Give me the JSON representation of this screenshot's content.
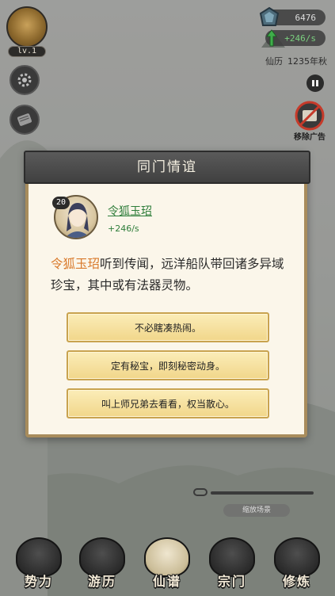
{
  "player": {
    "level_label": "lv.1"
  },
  "resources": {
    "spirit_stones": "6476",
    "rate": "+246/s"
  },
  "calendar": {
    "label": "仙历",
    "year": "1235年秋"
  },
  "remove_ad": {
    "label": "移除广告"
  },
  "dialog": {
    "title": "同门情谊",
    "character": {
      "level": "20",
      "name": "令狐玉玿",
      "rate": "+246/s"
    },
    "event": {
      "name": "令狐玉玿",
      "text": "听到传闻，远洋船队带回诸多异域珍宝，其中或有法器灵物。"
    },
    "choices": [
      {
        "label": "不必瞎凑热闹。"
      },
      {
        "label": "定有秘宝，即刻秘密动身。"
      },
      {
        "label": "叫上师兄弟去看看，权当散心。"
      }
    ]
  },
  "zoom_label": "缩放场景",
  "nav": [
    {
      "label": "势力"
    },
    {
      "label": "游历"
    },
    {
      "label": "仙谱"
    },
    {
      "label": "宗门"
    },
    {
      "label": "修炼"
    }
  ],
  "colors": {
    "accent_name": "#2e7d3a",
    "highlight": "#d97a2c",
    "choice_bg": "#f1d68a"
  }
}
